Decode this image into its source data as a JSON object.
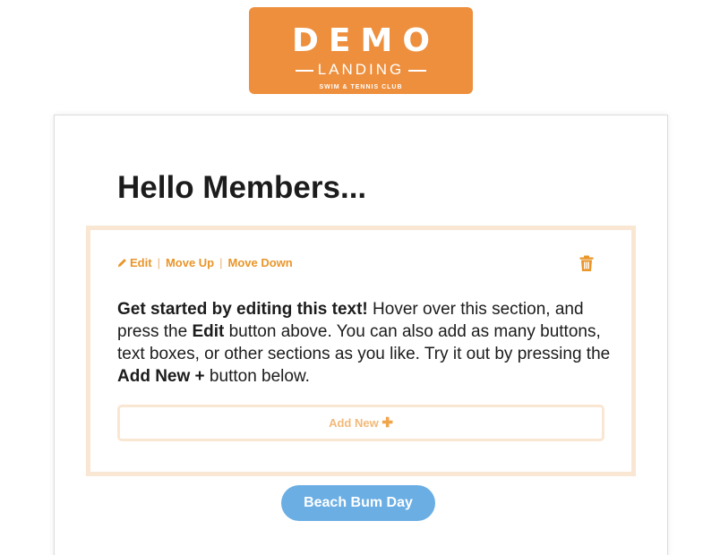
{
  "logo": {
    "title": "DEMO",
    "subtitle": "LANDING",
    "tagline": "SWIM & TENNIS CLUB",
    "background": "#ee8f3d"
  },
  "page": {
    "heading": "Hello Members..."
  },
  "section": {
    "toolbar": {
      "edit_icon": "pencil-icon",
      "edit_label": "Edit",
      "move_up_label": "Move Up",
      "move_down_label": "Move Down",
      "delete_icon": "trash-icon",
      "accent_color": "#e9952a"
    },
    "body": {
      "bold_intro": "Get started by editing this text!",
      "part1": " Hover over this section, and press the ",
      "edit_word": "Edit",
      "part2": " button above. You can also add as many buttons, text boxes, or other sections as you like. Try it out by pressing the ",
      "add_new_word": "Add New +",
      "part3": " button below."
    },
    "add_new_label": "Add New",
    "add_new_icon": "plus-icon"
  },
  "cta": {
    "label": "Beach Bum Day",
    "color": "#6aaee4"
  }
}
